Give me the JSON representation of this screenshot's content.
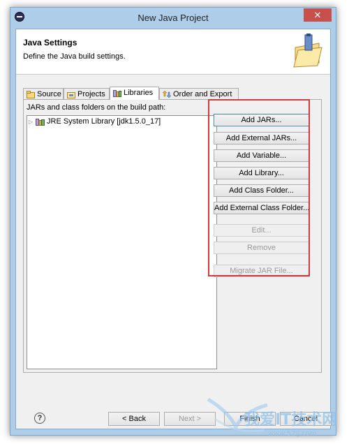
{
  "window": {
    "title": "New Java Project",
    "close_glyph": "✕"
  },
  "header": {
    "title": "Java Settings",
    "description": "Define the Java build settings."
  },
  "tabs": [
    {
      "label": "Source",
      "icon": "source-folder-icon",
      "active": false
    },
    {
      "label": "Projects",
      "icon": "projects-icon",
      "active": false
    },
    {
      "label": "Libraries",
      "icon": "libraries-icon",
      "active": true
    },
    {
      "label": "Order and Export",
      "icon": "order-export-icon",
      "active": false
    }
  ],
  "libraries": {
    "label": "JARs and class folders on the build path:",
    "tree": [
      {
        "label": "JRE System Library [jdk1.5.0_17]",
        "expanded": false
      }
    ],
    "buttons": [
      {
        "label": "Add JARs...",
        "enabled": true,
        "focused": true
      },
      {
        "label": "Add External JARs...",
        "enabled": true
      },
      {
        "label": "Add Variable...",
        "enabled": true
      },
      {
        "label": "Add Library...",
        "enabled": true
      },
      {
        "label": "Add Class Folder...",
        "enabled": true
      },
      {
        "label": "Add External Class Folder...",
        "enabled": true
      },
      {
        "label": "Edit...",
        "enabled": false
      },
      {
        "label": "Remove",
        "enabled": false
      },
      {
        "label": "Migrate JAR File...",
        "enabled": false
      }
    ]
  },
  "footer": {
    "help_glyph": "?",
    "back": "< Back",
    "next": "Next >",
    "finish": "Finish",
    "cancel": "Cancel"
  },
  "watermark": {
    "text": "我爱IT技术网",
    "sub": "www.52ij.com"
  },
  "colors": {
    "frame": "#aecde9",
    "close": "#c7504b",
    "highlight": "#d43a3a"
  }
}
